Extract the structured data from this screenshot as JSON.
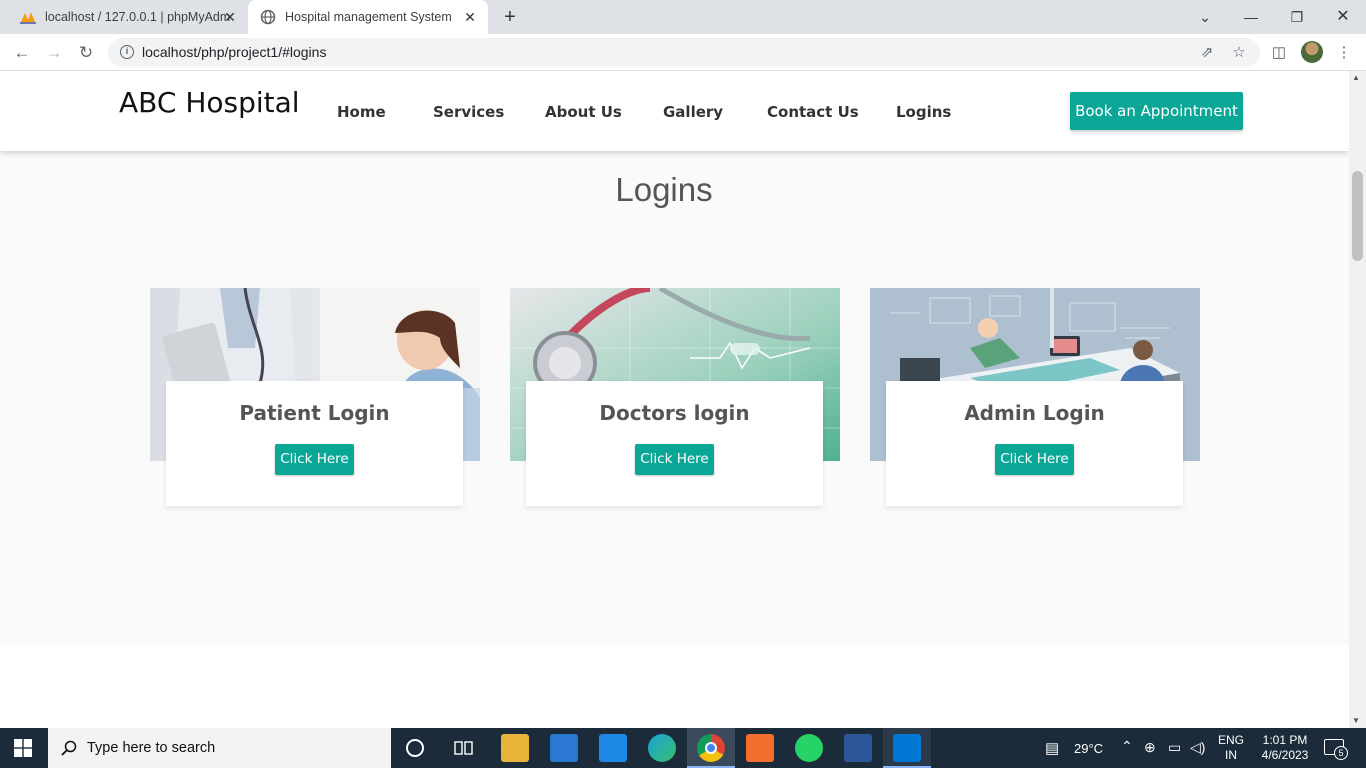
{
  "browser": {
    "tabs": [
      {
        "title": "localhost / 127.0.0.1 | phpMyAdm",
        "active": false
      },
      {
        "title": "Hospital management System",
        "active": true
      }
    ],
    "url": "localhost/php/project1/#logins"
  },
  "site": {
    "brand": "ABC Hospital",
    "nav": [
      "Home",
      "Services",
      "About Us",
      "Gallery",
      "Contact Us",
      "Logins"
    ],
    "cta_label": "Book an Appointment",
    "section_title": "Logins",
    "cards": [
      {
        "title": "Patient Login",
        "button": "Click Here"
      },
      {
        "title": "Doctors login",
        "button": "Click Here"
      },
      {
        "title": "Admin Login",
        "button": "Click Here"
      }
    ]
  },
  "taskbar": {
    "search_placeholder": "Type here to search",
    "weather": "29°C",
    "lang": "ENG",
    "region": "IN",
    "time": "1:01 PM",
    "date": "4/6/2023",
    "notifications": "5"
  },
  "colors": {
    "accent": "#0aa796",
    "taskbar": "#1b2b3a"
  }
}
